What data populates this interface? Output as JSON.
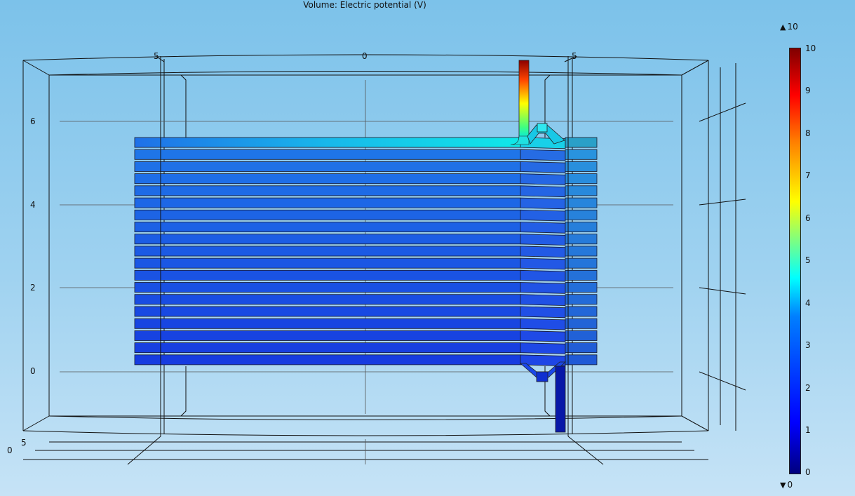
{
  "plot": {
    "title": "Volume: Electric potential (V)",
    "x_ticks": [
      "5",
      "0",
      "5"
    ],
    "y_ticks": [
      "6",
      "4",
      "2",
      "0"
    ],
    "z_ticks": [
      "5",
      "0"
    ]
  },
  "colorbar": {
    "max_label": "10",
    "min_label": "0",
    "labels": [
      "10",
      "9",
      "8",
      "7",
      "6",
      "5",
      "4",
      "3",
      "2",
      "1",
      "0"
    ],
    "colors": {
      "dark_blue": "#00007f",
      "blue": "#0000ff",
      "light_blue": "#007fff",
      "cyan": "#00ffff",
      "green": "#7fff7f",
      "yellow": "#ffff00",
      "orange": "#ff7f00",
      "red": "#ff0000",
      "dark_red": "#7f0000"
    }
  },
  "coil": {
    "turns": 19,
    "potential_min": 0,
    "potential_max": 10
  }
}
